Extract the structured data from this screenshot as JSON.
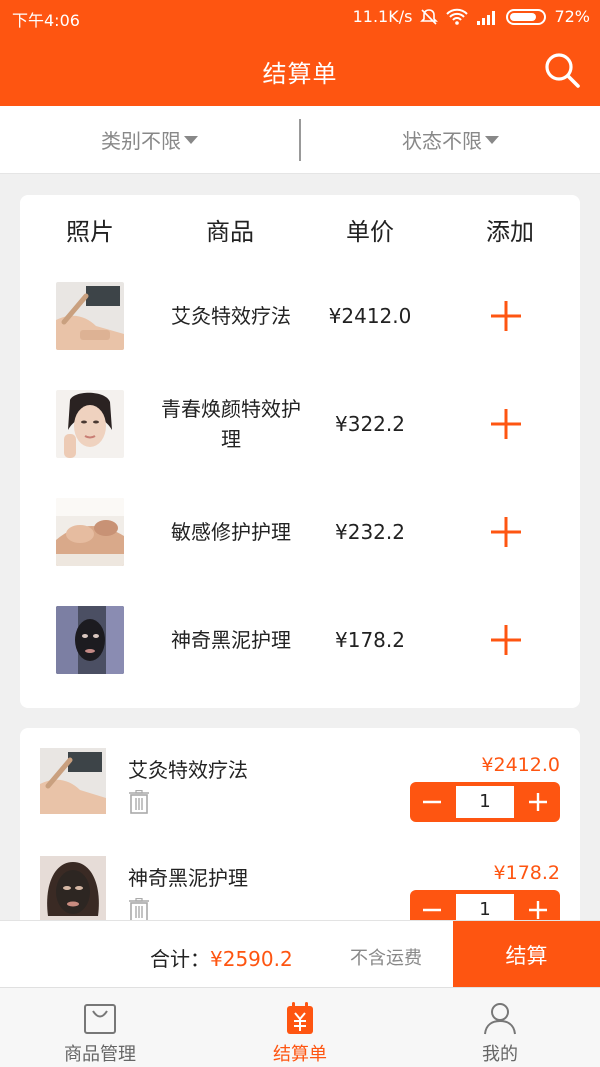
{
  "status_bar": {
    "time": "下午4:06",
    "speed": "11.1K/s",
    "battery": "72%"
  },
  "header": {
    "title": "结算单"
  },
  "filters": [
    {
      "label": "类别不限"
    },
    {
      "label": "状态不限"
    }
  ],
  "product_table": {
    "columns": [
      "照片",
      "商品",
      "单价",
      "添加"
    ],
    "rows": [
      {
        "name": "艾灸特效疗法",
        "price": "¥2412.0",
        "photo": "moxibustion-photo"
      },
      {
        "name": "青春焕颜特效护理",
        "price": "¥322.2",
        "photo": "face-care-photo"
      },
      {
        "name": "敏感修护护理",
        "price": "¥232.2",
        "photo": "facial-massage-photo"
      },
      {
        "name": "神奇黑泥护理",
        "price": "¥178.2",
        "photo": "black-mud-mask-photo"
      }
    ]
  },
  "cart": {
    "items": [
      {
        "name": "艾灸特效疗法",
        "price": "¥2412.0",
        "qty": "1",
        "photo": "moxibustion-photo"
      },
      {
        "name": "神奇黑泥护理",
        "price": "¥178.2",
        "qty": "1",
        "photo": "black-mud-mask-photo"
      }
    ]
  },
  "totals": {
    "label": "合计：",
    "amount": "¥2590.2",
    "shipping_note": "不含运费",
    "checkout_label": "结算"
  },
  "bottom_nav": [
    {
      "label": "商品管理",
      "icon": "shopping-bag-icon",
      "active": false
    },
    {
      "label": "结算单",
      "icon": "bill-icon",
      "active": true
    },
    {
      "label": "我的",
      "icon": "user-icon",
      "active": false
    }
  ],
  "colors": {
    "accent": "#fe5511",
    "background": "#f0f0f0"
  }
}
